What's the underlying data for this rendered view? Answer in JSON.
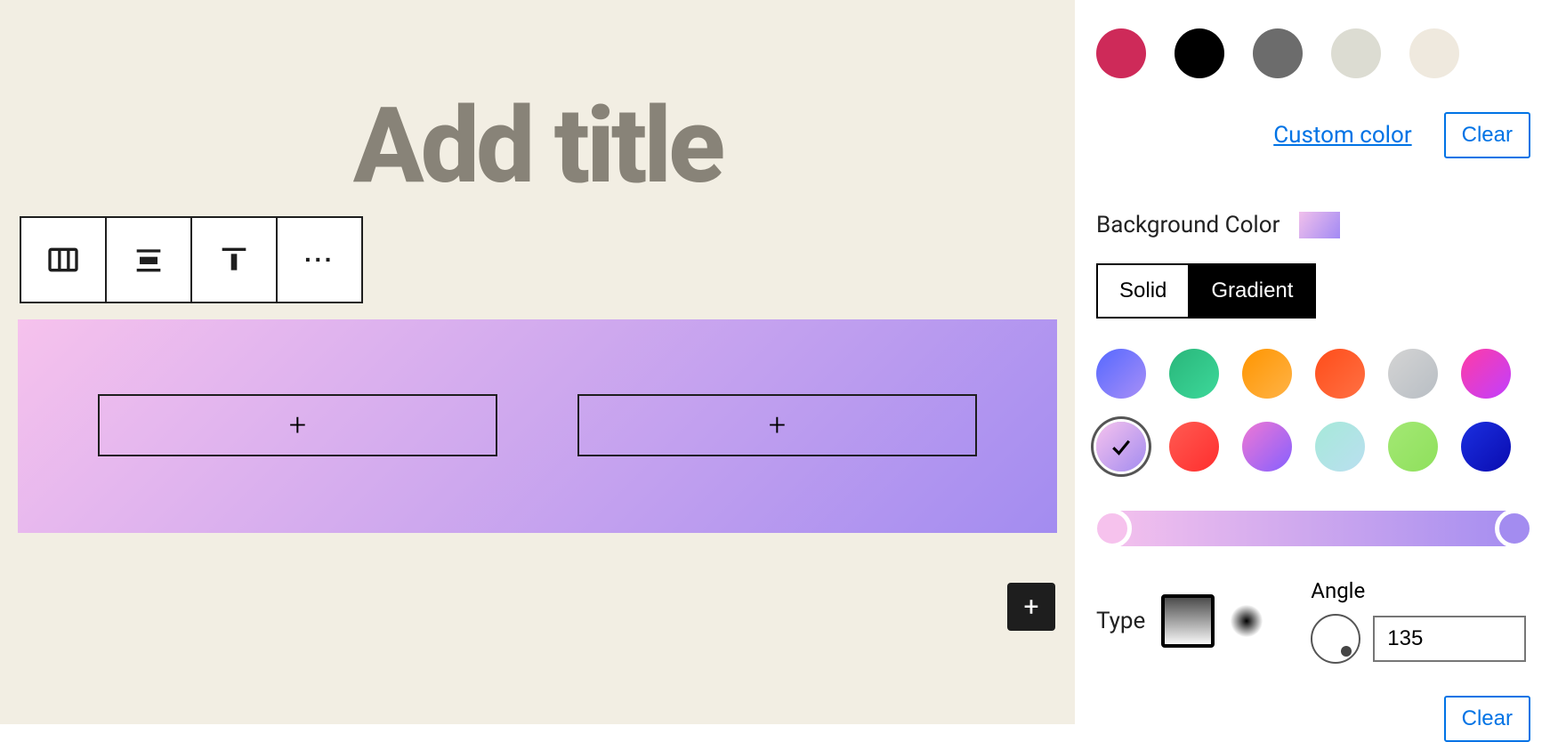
{
  "editor": {
    "title_placeholder": "Add title",
    "column_appender_glyph": "+",
    "inserter_glyph": "+",
    "columns_gradient_start": "#f6c2ed",
    "columns_gradient_end": "#a38cf0",
    "columns_gradient_angle": 135
  },
  "toolbar": {
    "items": [
      "columns-block",
      "align-center",
      "align-top",
      "more"
    ]
  },
  "sidebar": {
    "text_color": {
      "swatches": [
        "#ce2a59",
        "#000000",
        "#6c6c6c",
        "#dcdcd2",
        "#efe9de"
      ],
      "custom_color_link": "Custom color",
      "clear_label": "Clear"
    },
    "background": {
      "label": "Background Color",
      "tabs": {
        "solid": "Solid",
        "gradient": "Gradient",
        "active": "gradient"
      },
      "gradient_presets": [
        {
          "name": "blue-purple",
          "start": "#5568ff",
          "end": "#a88ff7"
        },
        {
          "name": "green",
          "start": "#29b67a",
          "end": "#3dd89a"
        },
        {
          "name": "orange",
          "start": "#ff9500",
          "end": "#ffb347"
        },
        {
          "name": "red-orange",
          "start": "#ff4d1a",
          "end": "#ff7043"
        },
        {
          "name": "gray",
          "start": "#d4d4d4",
          "end": "#b8bec4"
        },
        {
          "name": "magenta-purple",
          "start": "#ff3ba5",
          "end": "#c13fff"
        },
        {
          "name": "pink-lavender",
          "start": "#f6c2ed",
          "end": "#a38cf0",
          "selected": true
        },
        {
          "name": "red",
          "start": "#ff5b52",
          "end": "#ff2e2e"
        },
        {
          "name": "pink-violet",
          "start": "#ef78d4",
          "end": "#8560ff"
        },
        {
          "name": "teal-light",
          "start": "#a6e9d9",
          "end": "#badff0"
        },
        {
          "name": "lime",
          "start": "#a3e874",
          "end": "#8fe05c"
        },
        {
          "name": "deep-blue",
          "start": "#1b2fe0",
          "end": "#0a0cb0"
        }
      ],
      "type_label": "Type",
      "type": "linear",
      "angle_label": "Angle",
      "angle_value": "135",
      "clear_label": "Clear"
    }
  }
}
